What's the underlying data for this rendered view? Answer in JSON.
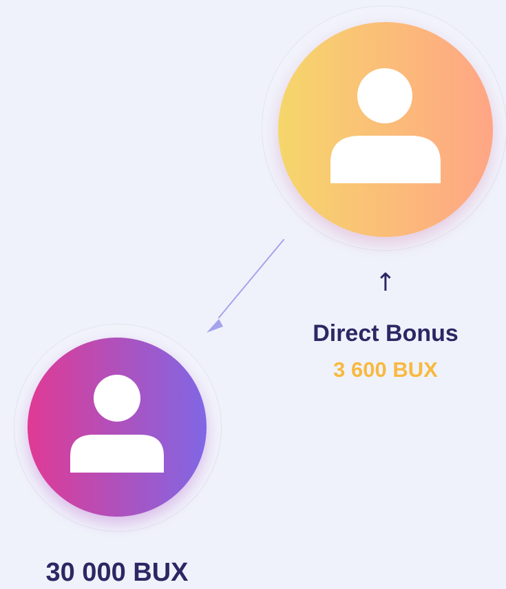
{
  "diagram": {
    "top_node": {
      "icon": "user-icon",
      "gradient": [
        "#f6d66b",
        "#ffa585"
      ]
    },
    "bottom_node": {
      "icon": "user-icon",
      "gradient": [
        "#e03a94",
        "#8067e4"
      ],
      "amount": "30 000 BUX"
    },
    "bonus": {
      "arrow": "↑",
      "title": "Direct Bonus",
      "amount": "3 600 BUX"
    },
    "colors": {
      "background": "#eff2fb",
      "text_primary": "#2d2763",
      "text_accent": "#f8b93f",
      "connector": "#a5a3ec"
    }
  }
}
